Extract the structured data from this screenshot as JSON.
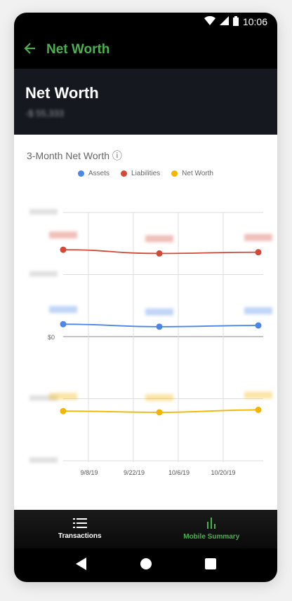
{
  "status": {
    "time": "10:06",
    "wifi_icon": "wifi-icon",
    "signal_icon": "signal-icon",
    "battery_icon": "battery-icon"
  },
  "appbar": {
    "title": "Net Worth",
    "back_icon": "arrow-left-icon"
  },
  "header": {
    "title": "Net Worth",
    "amount": "-$ 55,333"
  },
  "chart_data": {
    "type": "line",
    "title": "3-Month Net Worth ⓘ",
    "x": [
      "9/8/19",
      "9/22/19",
      "10/6/19",
      "10/20/19"
    ],
    "ylabels": [
      "$0"
    ],
    "series": [
      {
        "name": "Assets",
        "color": "#4a86e8",
        "values": [
          10,
          8,
          9
        ]
      },
      {
        "name": "Liabilities",
        "color": "#d34836",
        "values": [
          70,
          67,
          68
        ]
      },
      {
        "name": "Net Worth",
        "color": "#f4b400",
        "values": [
          -60,
          -61,
          -59
        ]
      }
    ],
    "legend_position": "top",
    "grid": true
  },
  "bottom_nav": {
    "items": [
      {
        "label": "Transactions",
        "icon": "list-icon",
        "active": false
      },
      {
        "label": "Mobile Summary",
        "icon": "bar-chart-icon",
        "active": true
      }
    ]
  },
  "android_nav": {
    "back_icon": "back-triangle-icon",
    "home_icon": "home-circle-icon",
    "recents_icon": "recents-square-icon"
  }
}
